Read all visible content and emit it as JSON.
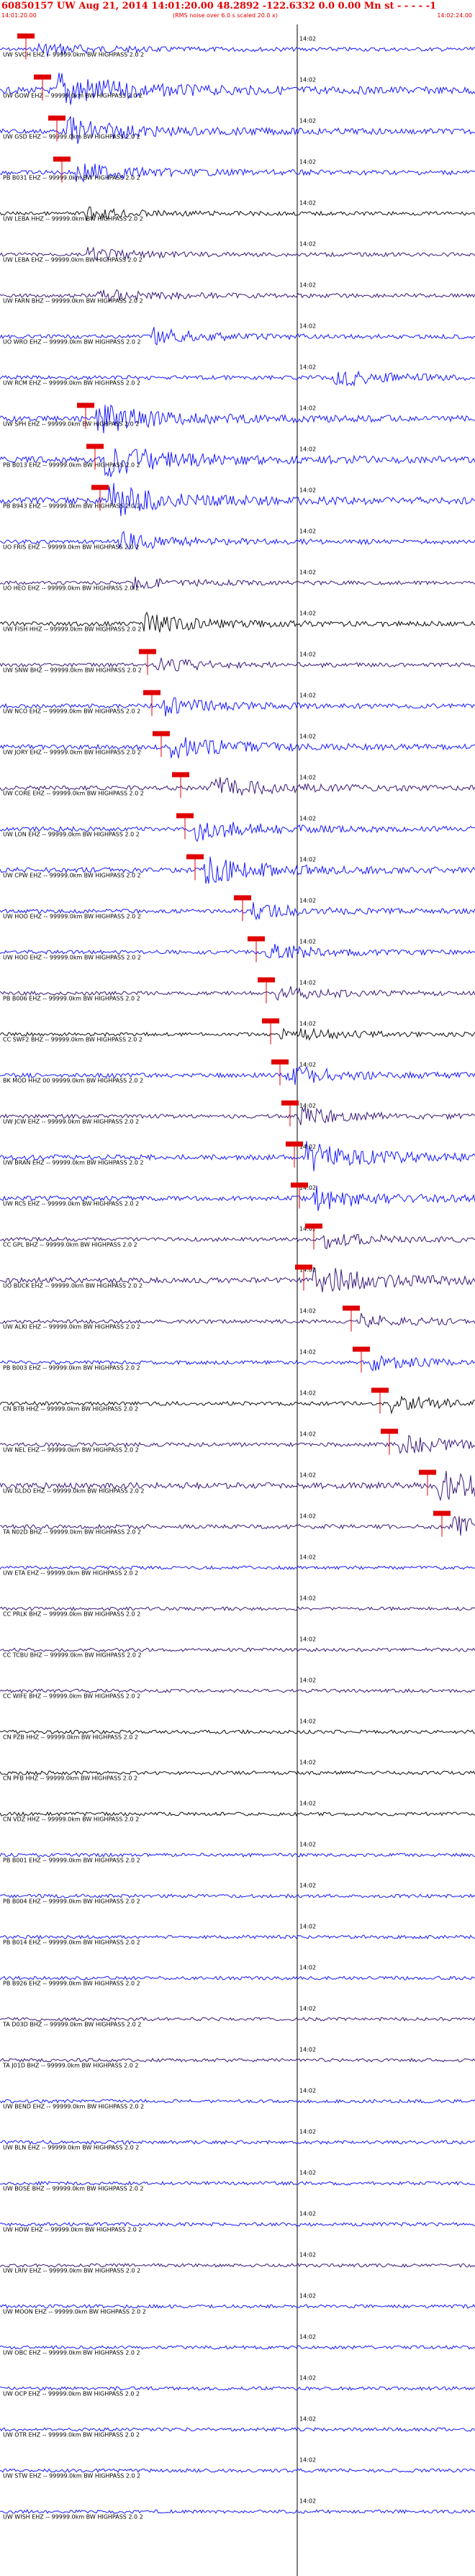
{
  "header": {
    "title": "60850157 UW Aug 21, 2014 14:01:20.00   48.2892 -122.6332  0.0 0.00 Mn st  - - - - -1",
    "start_time": "14:01:20.00",
    "rms_note": "(RMS noise over 6.0 s scaled 20.0 x)",
    "end_time": "14:02:24.00"
  },
  "colors": {
    "blue": "#1a1aff",
    "purple": "#3a1a7a",
    "black": "#111111",
    "red": "#e00000",
    "minute_line": "#000000"
  },
  "chart_data": {
    "type": "line",
    "title": "60850157 UW Aug 21, 2014 14:01:20.00",
    "x_range": [
      "14:01:20.00",
      "14:02:24.00"
    ],
    "minute_tick_label": "14:02",
    "traces": [
      {
        "label": "UW SVOH EHZ -- 99999.0km BW  HIGHPASS  2.0  2",
        "color": "blue",
        "pick": 0.055,
        "event": 0.08,
        "amp": 0.35
      },
      {
        "label": "UW GOW EHZ -- 99999.0km BW  HIGHPASS  2.0  2",
        "color": "blue",
        "pick": 0.09,
        "event": 0.12,
        "amp": 1.0
      },
      {
        "label": "UW GSD EHZ -- 99999.0km BW  HIGHPASS  2.0  2",
        "color": "blue",
        "pick": 0.12,
        "event": 0.14,
        "amp": 0.7
      },
      {
        "label": "PB B031 EHZ -- 99999.0km BW  HIGHPASS  2.0  2",
        "color": "blue",
        "pick": 0.13,
        "event": 0.16,
        "amp": 0.5
      },
      {
        "label": "UW LEBA HHZ -- 99999.0km BW  HIGHPASS  2.0  2",
        "color": "black",
        "pick": null,
        "event": 0.18,
        "amp": 0.3
      },
      {
        "label": "UW LEBA EHZ -- 99999.0km BW  HIGHPASS  2.0  2",
        "color": "purple",
        "pick": null,
        "event": 0.18,
        "amp": 0.3
      },
      {
        "label": "UW FARN BHZ -- 99999.0km BW  HIGHPASS  2.0  2",
        "color": "purple",
        "pick": null,
        "event": 0.2,
        "amp": 0.35
      },
      {
        "label": "UO WRO EHZ -- 99999.0km BW  HIGHPASS  2.0  2",
        "color": "blue",
        "pick": null,
        "event": 0.32,
        "amp": 0.4
      },
      {
        "label": "UW RCM EHZ -- 99999.0km BW  HIGHPASS  2.0  2",
        "color": "blue",
        "pick": null,
        "event": 0.7,
        "amp": 0.45
      },
      {
        "label": "UW SPH EHZ -- 99999.0km BW  HIGHPASS  2.0  2",
        "color": "blue",
        "pick": 0.18,
        "event": 0.2,
        "amp": 0.8
      },
      {
        "label": "PB B013 EHZ -- 99999.0km BW  HIGHPASS  2.0  2",
        "color": "blue",
        "pick": 0.2,
        "event": 0.22,
        "amp": 0.9
      },
      {
        "label": "PB B943 EHZ -- 99999.0km BW  HIGHPASS  2.0  2",
        "color": "blue",
        "pick": 0.21,
        "event": 0.23,
        "amp": 0.9
      },
      {
        "label": "UO FRIS EHZ -- 99999.0km BW  HIGHPASS  2.0  2",
        "color": "blue",
        "pick": null,
        "event": 0.25,
        "amp": 0.45
      },
      {
        "label": "UO HEO EHZ -- 99999.0km BW  HIGHPASS  2.0  2",
        "color": "purple",
        "pick": null,
        "event": 0.28,
        "amp": 0.3
      },
      {
        "label": "UW FISH HHZ -- 99999.0km BW  HIGHPASS  2.0  2",
        "color": "black",
        "pick": null,
        "event": 0.3,
        "amp": 0.5
      },
      {
        "label": "UW SNW BHZ -- 99999.0km BW  HIGHPASS  2.0  2",
        "color": "purple",
        "pick": 0.31,
        "event": 0.33,
        "amp": 0.35
      },
      {
        "label": "UW NCO EHZ -- 99999.0km BW  HIGHPASS  2.0  2",
        "color": "blue",
        "pick": 0.32,
        "event": 0.34,
        "amp": 0.45
      },
      {
        "label": "UW JORY EHZ -- 99999.0km BW  HIGHPASS  2.0  2",
        "color": "blue",
        "pick": 0.34,
        "event": 0.36,
        "amp": 0.6
      },
      {
        "label": "UW CORE EHZ -- 99999.0km BW  HIGHPASS  2.0  2",
        "color": "purple",
        "pick": 0.38,
        "event": 0.44,
        "amp": 0.55
      },
      {
        "label": "UW LON EHZ -- 99999.0km BW  HIGHPASS  2.0  2",
        "color": "blue",
        "pick": 0.39,
        "event": 0.41,
        "amp": 0.55
      },
      {
        "label": "UW CPW EHZ -- 99999.0km BW  HIGHPASS  2.0  2",
        "color": "blue",
        "pick": 0.41,
        "event": 0.43,
        "amp": 0.7
      },
      {
        "label": "UW HOO EHZ -- 99999.0km BW  HIGHPASS  2.0  2",
        "color": "blue",
        "pick": 0.51,
        "event": 0.53,
        "amp": 0.4
      },
      {
        "label": "UW HOO EHZ -- 99999.0km BW  HIGHPASS  2.0  2",
        "color": "blue",
        "pick": 0.54,
        "event": 0.56,
        "amp": 0.4
      },
      {
        "label": "PB B006 EHZ -- 99999.0km BW  HIGHPASS  2.0  2",
        "color": "purple",
        "pick": 0.56,
        "event": 0.58,
        "amp": 0.35
      },
      {
        "label": "CC SWF2 BHZ -- 99999.0km BW  HIGHPASS  2.0  2",
        "color": "black",
        "pick": 0.57,
        "event": 0.59,
        "amp": 0.35
      },
      {
        "label": "BK MOD HHZ 00 99999.0km BW  HIGHPASS  2.0  2",
        "color": "blue",
        "pick": 0.59,
        "event": 0.6,
        "amp": 0.5
      },
      {
        "label": "UW JCW EHZ -- 99999.0km BW  HIGHPASS  2.0  2",
        "color": "purple",
        "pick": 0.61,
        "event": 0.63,
        "amp": 0.4
      },
      {
        "label": "UW BRAN EHZ -- 99999.0km BW  HIGHPASS  2.0  2",
        "color": "blue",
        "pick": 0.62,
        "event": 0.64,
        "amp": 0.75
      },
      {
        "label": "UW RCS EHZ -- 99999.0km BW  HIGHPASS  2.0  2",
        "color": "blue",
        "pick": 0.63,
        "event": 0.66,
        "amp": 0.6
      },
      {
        "label": "CC GPL BHZ -- 99999.0km BW  HIGHPASS  2.0  2",
        "color": "purple",
        "pick": 0.66,
        "event": 0.68,
        "amp": 0.4
      },
      {
        "label": "UO BUCK EHZ -- 99999.0km BW  HIGHPASS  2.0  2",
        "color": "purple",
        "pick": 0.64,
        "event": 0.66,
        "amp": 0.8
      },
      {
        "label": "UW ALKI EHZ -- 99999.0km BW  HIGHPASS  2.0  2",
        "color": "purple",
        "pick": 0.74,
        "event": 0.76,
        "amp": 0.35
      },
      {
        "label": "PB B003 EHZ -- 99999.0km BW  HIGHPASS  2.0  2",
        "color": "blue",
        "pick": 0.76,
        "event": 0.78,
        "amp": 0.35
      },
      {
        "label": "CN BTB HHZ -- 99999.0km BW  HIGHPASS  2.0  2",
        "color": "black",
        "pick": 0.8,
        "event": 0.82,
        "amp": 0.4
      },
      {
        "label": "UW NEL EHZ -- 99999.0km BW  HIGHPASS  2.0  2",
        "color": "purple",
        "pick": 0.82,
        "event": 0.84,
        "amp": 0.45
      },
      {
        "label": "UW GLDO EHZ -- 99999.0km BW  HIGHPASS  2.0  2",
        "color": "purple",
        "pick": 0.9,
        "event": 0.92,
        "amp": 0.9
      },
      {
        "label": "TA N02D BHZ -- 99999.0km BW  HIGHPASS  2.0  2",
        "color": "purple",
        "pick": 0.93,
        "event": 0.95,
        "amp": 0.5
      },
      {
        "label": "UW ETA EHZ -- 99999.0km BW  HIGHPASS  2.0  2",
        "color": "blue",
        "pick": null,
        "event": null,
        "amp": 0.3
      },
      {
        "label": "CC PRLK BHZ -- 99999.0km BW  HIGHPASS  2.0  2",
        "color": "purple",
        "pick": null,
        "event": null,
        "amp": 0.3
      },
      {
        "label": "CC TCBU BHZ -- 99999.0km BW  HIGHPASS  2.0  2",
        "color": "purple",
        "pick": null,
        "event": null,
        "amp": 0.3
      },
      {
        "label": "CC WIFE BHZ -- 99999.0km BW  HIGHPASS  2.0  2",
        "color": "purple",
        "pick": null,
        "event": null,
        "amp": 0.3
      },
      {
        "label": "CN PZB HHZ -- 99999.0km BW  HIGHPASS  2.0  2",
        "color": "black",
        "pick": null,
        "event": null,
        "amp": 0.35
      },
      {
        "label": "CN PFB HHZ -- 99999.0km BW  HIGHPASS  2.0  2",
        "color": "black",
        "pick": null,
        "event": null,
        "amp": 0.35
      },
      {
        "label": "CN VDZ HHZ -- 99999.0km BW  HIGHPASS  2.0  2",
        "color": "black",
        "pick": null,
        "event": null,
        "amp": 0.35
      },
      {
        "label": "PB B001 EHZ -- 99999.0km BW  HIGHPASS  2.0  2",
        "color": "blue",
        "pick": null,
        "event": null,
        "amp": 0.3
      },
      {
        "label": "PB B004 EHZ -- 99999.0km BW  HIGHPASS  2.0  2",
        "color": "blue",
        "pick": null,
        "event": null,
        "amp": 0.3
      },
      {
        "label": "PB B014 EHZ -- 99999.0km BW  HIGHPASS  2.0  2",
        "color": "blue",
        "pick": null,
        "event": null,
        "amp": 0.3
      },
      {
        "label": "PB B926 EHZ -- 99999.0km BW  HIGHPASS  2.0  2",
        "color": "blue",
        "pick": null,
        "event": null,
        "amp": 0.3
      },
      {
        "label": "TA D03D BHZ -- 99999.0km BW  HIGHPASS  2.0  2",
        "color": "purple",
        "pick": null,
        "event": null,
        "amp": 0.3
      },
      {
        "label": "TA J01D BHZ -- 99999.0km BW  HIGHPASS  2.0  2",
        "color": "purple",
        "pick": null,
        "event": null,
        "amp": 0.3
      },
      {
        "label": "UW BEND EHZ -- 99999.0km BW  HIGHPASS  2.0  2",
        "color": "blue",
        "pick": null,
        "event": null,
        "amp": 0.3
      },
      {
        "label": "UW BLN EHZ -- 99999.0km BW  HIGHPASS  2.0  2",
        "color": "blue",
        "pick": null,
        "event": null,
        "amp": 0.35
      },
      {
        "label": "UW BOSE BHZ -- 99999.0km BW  HIGHPASS  2.0  2",
        "color": "blue",
        "pick": null,
        "event": null,
        "amp": 0.3
      },
      {
        "label": "UW HDW EHZ -- 99999.0km BW  HIGHPASS  2.0  2",
        "color": "blue",
        "pick": null,
        "event": null,
        "amp": 0.3
      },
      {
        "label": "UW LRIV EHZ -- 99999.0km BW  HIGHPASS  2.0  2",
        "color": "purple",
        "pick": null,
        "event": null,
        "amp": 0.3
      },
      {
        "label": "UW MOON EHZ -- 99999.0km BW  HIGHPASS  2.0  2",
        "color": "blue",
        "pick": null,
        "event": null,
        "amp": 0.3
      },
      {
        "label": "UW OBC EHZ -- 99999.0km BW  HIGHPASS  2.0  2",
        "color": "blue",
        "pick": null,
        "event": null,
        "amp": 0.3
      },
      {
        "label": "UW OCP EHZ -- 99999.0km BW  HIGHPASS  2.0  2",
        "color": "blue",
        "pick": null,
        "event": null,
        "amp": 0.3
      },
      {
        "label": "UW OTR EHZ -- 99999.0km BW  HIGHPASS  2.0  2",
        "color": "blue",
        "pick": null,
        "event": null,
        "amp": 0.3
      },
      {
        "label": "UW STW EHZ -- 99999.0km BW  HIGHPASS  2.0  2",
        "color": "blue",
        "pick": null,
        "event": null,
        "amp": 0.3
      },
      {
        "label": "UW WISH EHZ -- 99999.0km BW  HIGHPASS  2.0  2",
        "color": "blue",
        "pick": null,
        "event": null,
        "amp": 0.3
      }
    ]
  }
}
